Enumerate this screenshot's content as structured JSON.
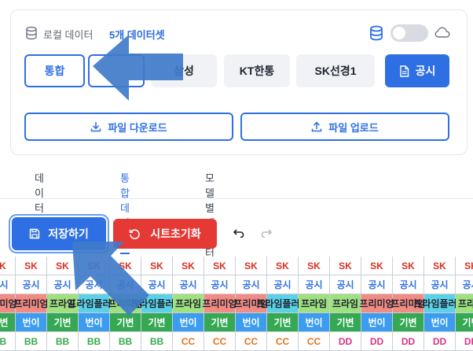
{
  "header": {
    "local_label": "로컬 데이터",
    "dataset_count": "5개 데이터셋",
    "storage_icon": "database-icon",
    "toggle_state": "off",
    "cloud_icon": "cloud-icon"
  },
  "dataset_tabs": [
    {
      "label": "통합",
      "style": "outline"
    },
    {
      "label": "",
      "style": "outline"
    },
    {
      "label": "삼성",
      "style": "gray"
    },
    {
      "label": "KT한통",
      "style": "gray"
    },
    {
      "label": "SK선경1",
      "style": "gray"
    },
    {
      "label": "공시",
      "style": "primary",
      "icon": "document-icon"
    }
  ],
  "file_buttons": {
    "download": "파일 다운로드",
    "upload": "파일 업로드"
  },
  "view_tabs": [
    {
      "label": "데이터 입력",
      "active": false
    },
    {
      "label": "통합 데이터",
      "active": true
    },
    {
      "label": "모델별 데이터",
      "active": false
    }
  ],
  "toolbar": {
    "save": "저장하기",
    "reset": "시트초기화"
  },
  "sheet": {
    "rows": [
      {
        "cells": [
          "SK",
          "SK",
          "SK",
          "SK",
          "SK",
          "SK",
          "SK",
          "SK",
          "SK",
          "SK",
          "SK",
          "SK",
          "SK",
          "SK",
          "SK",
          "SK"
        ],
        "color": "#d93025",
        "bg": [
          "#ffffff",
          "#ffffff",
          "#ffffff",
          "#ffffff",
          "#ffffff",
          "#ffffff",
          "#ffffff",
          "#ffffff",
          "#ffffff",
          "#ffffff",
          "#ffffff",
          "#ffffff",
          "#ffffff",
          "#ffffff",
          "#ffffff",
          "#ffffff"
        ]
      },
      {
        "cells": [
          "공시",
          "공시",
          "공시",
          "공시",
          "공시",
          "공시",
          "공시",
          "공시",
          "공시",
          "공시",
          "공시",
          "공시",
          "공시",
          "공시",
          "공시",
          "공시"
        ],
        "color": "#2f6fe4",
        "bg": [
          "#ffffff",
          "#ffffff",
          "#ffffff",
          "#ffffff",
          "#ffffff",
          "#ffffff",
          "#ffffff",
          "#ffffff",
          "#ffffff",
          "#ffffff",
          "#ffffff",
          "#ffffff",
          "#ffffff",
          "#ffffff",
          "#ffffff",
          "#ffffff"
        ]
      },
      {
        "cells": [
          "프리미엄",
          "프리미엄",
          "프라임",
          "프라임플러스",
          "프리미엄",
          "프라임플러스",
          "프라임",
          "프리미엄",
          "프리미엄",
          "프라임플러스",
          "프라임",
          "프라임",
          "프리미엄",
          "프리미엄",
          "프라임플러스",
          "프라임"
        ],
        "color": "#1f2430",
        "bg": [
          "#f28b82",
          "#f28b82",
          "#9fe07f",
          "#5bd1e6",
          "#9fe07f",
          "#5bd1e6",
          "#9fe07f",
          "#f28b82",
          "#f28b82",
          "#5bd1e6",
          "#9fe07f",
          "#9fe07f",
          "#f28b82",
          "#f28b82",
          "#5bd1e6",
          "#9fe07f"
        ]
      },
      {
        "cells": [
          "기변",
          "번이",
          "기변",
          "번이",
          "기변",
          "기변",
          "번이",
          "기변",
          "번이",
          "기변",
          "번이",
          "기변",
          "번이",
          "기변",
          "번이",
          "기변"
        ],
        "color": "#ffffff",
        "bg": [
          "#34a853",
          "#3b9cf0",
          "#34a853",
          "#3b9cf0",
          "#34a853",
          "#34a853",
          "#3b9cf0",
          "#34a853",
          "#3b9cf0",
          "#34a853",
          "#3b9cf0",
          "#34a853",
          "#3b9cf0",
          "#34a853",
          "#3b9cf0",
          "#34a853"
        ]
      },
      {
        "cells": [
          "BB",
          "BB",
          "BB",
          "BB",
          "BB",
          "BB",
          "CC",
          "CC",
          "CC",
          "CC",
          "CC",
          "DD",
          "DD",
          "DD",
          "DD",
          "DD"
        ],
        "color": "#3aa84f",
        "bg": [
          "#ffffff",
          "#ffffff",
          "#ffffff",
          "#ffffff",
          "#ffffff",
          "#ffffff",
          "#ffffff",
          "#ffffff",
          "#ffffff",
          "#ffffff",
          "#ffffff",
          "#ffffff",
          "#ffffff",
          "#ffffff",
          "#ffffff",
          "#ffffff"
        ]
      }
    ],
    "cc_color": "#e8711a",
    "dd_color": "#d63384"
  },
  "colors": {
    "accent": "#2f6fe4",
    "danger": "#e53935",
    "overlay_arrow": "#3f7bc9"
  }
}
